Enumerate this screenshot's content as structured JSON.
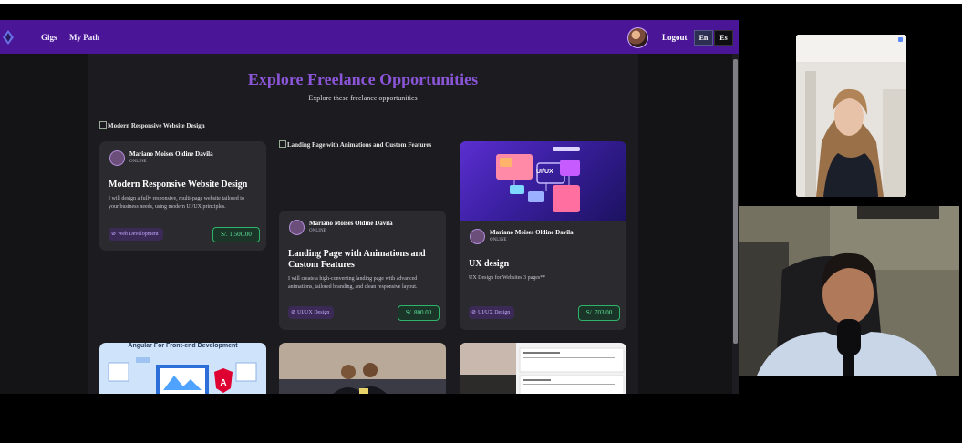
{
  "nav": {
    "links": [
      "Gigs",
      "My Path"
    ],
    "logout_label": "Logout",
    "lang_en": "En",
    "lang_es": "Es"
  },
  "page": {
    "title": "Explore Freelance Opportunities",
    "subtitle": "Explore these freelance opportunities"
  },
  "cards": [
    {
      "image_alt": "Modern Responsive Website Design",
      "author": "Mariano Moises Oldine Davila",
      "author_tag": "ONLINE",
      "title": "Modern Responsive Website Design",
      "description_1": "I will design a fully responsive, multi-page website tailored to",
      "description_2": "your business needs, using modern UI/UX principles.",
      "tag": "Web Development",
      "price": "S/. 1,500.00"
    },
    {
      "image_alt": "Landing Page with Animations and Custom Features",
      "author": "Mariano Moises Oldine Davila",
      "author_tag": "ONLINE",
      "title_1": "Landing Page with Animations and",
      "title_2": "Custom Features",
      "description_1": "I will create a high-converting landing page with advanced",
      "description_2": "animations, tailored branding, and clean responsive layout.",
      "tag": "UI/UX Design",
      "price": "S/. 800.00"
    },
    {
      "image_label": "UI/UX",
      "author": "Mariano Moises Oldine Davila",
      "author_tag": "ONLINE",
      "title": "UX design",
      "description_1": "UX Design for Websites 3 pages**",
      "tag": "UI/UX Design",
      "price": "S/. 703.00"
    }
  ],
  "bottom_cards": [
    {
      "image_caption": "Angular For Front-end Development"
    },
    {
      "image_caption": ""
    },
    {
      "image_caption": ""
    }
  ],
  "icons": {
    "logo": "app-logo-icon",
    "tag": "tag-icon",
    "broken_image": "broken-image-icon"
  },
  "colors": {
    "nav_bg": "#4a1596",
    "title": "#8b55d8",
    "price_green": "#5be39a"
  }
}
